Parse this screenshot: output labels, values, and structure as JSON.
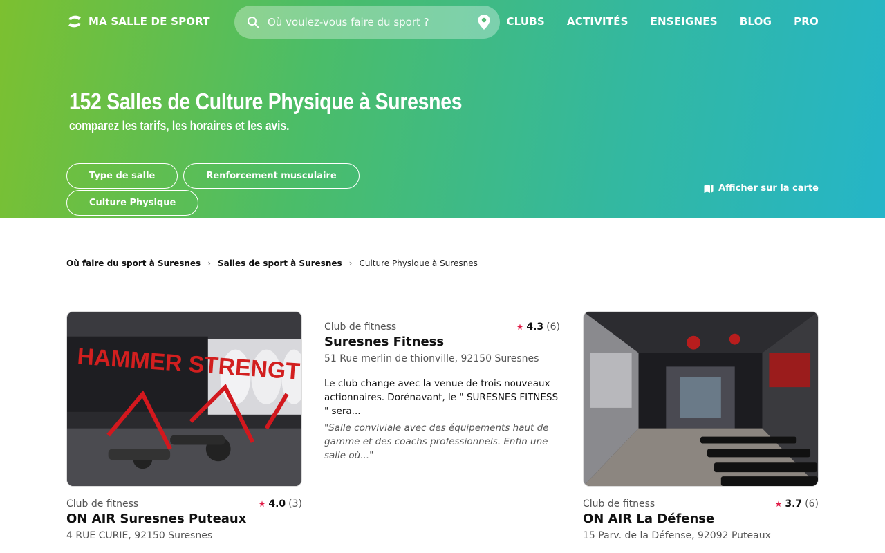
{
  "header": {
    "logo_text": "MA SALLE DE SPORT",
    "search_placeholder": "Où voulez-vous faire du sport ?",
    "nav": [
      "CLUBS",
      "ACTIVITÉS",
      "ENSEIGNES",
      "BLOG",
      "PRO"
    ]
  },
  "hero": {
    "title": "152 Salles de Culture Physique à Suresnes",
    "subtitle": "comparez les tarifs, les horaires et les avis.",
    "filters": [
      "Type de salle",
      "Renforcement musculaire",
      "Culture Physique"
    ],
    "map_link": "Afficher sur la carte"
  },
  "breadcrumb": {
    "items": [
      "Où faire du sport à Suresnes",
      "Salles de sport à Suresnes"
    ],
    "current": "Culture Physique à Suresnes"
  },
  "clubs": [
    {
      "category": "Club de fitness",
      "rating": "4.0",
      "reviews": "(3)",
      "name": "ON AIR Suresnes Puteaux",
      "address": "4 RUE CURIE, 92150 Suresnes",
      "image_text": "HAMMER STRENGTH"
    },
    {
      "category": "Club de fitness",
      "rating": "4.3",
      "reviews": "(6)",
      "name": "Suresnes Fitness",
      "address": "51 Rue merlin de thionville, 92150 Suresnes",
      "description": "Le club change avec la venue de trois nouveaux actionnaires. Dorénavant, le \" SURESNES FITNESS \" sera...",
      "review": "\"Salle conviviale avec des équipements haut de gamme et des coachs professionnels. Enfin une salle où...\""
    },
    {
      "category": "Club de fitness",
      "rating": "3.7",
      "reviews": "(6)",
      "name": "ON AIR La Défense",
      "address": "15 Parv. de la Défense, 92092 Puteaux"
    }
  ],
  "colors": {
    "gradient_start": "#7cc030",
    "gradient_end": "#25b5c8",
    "star": "#e11d48"
  }
}
